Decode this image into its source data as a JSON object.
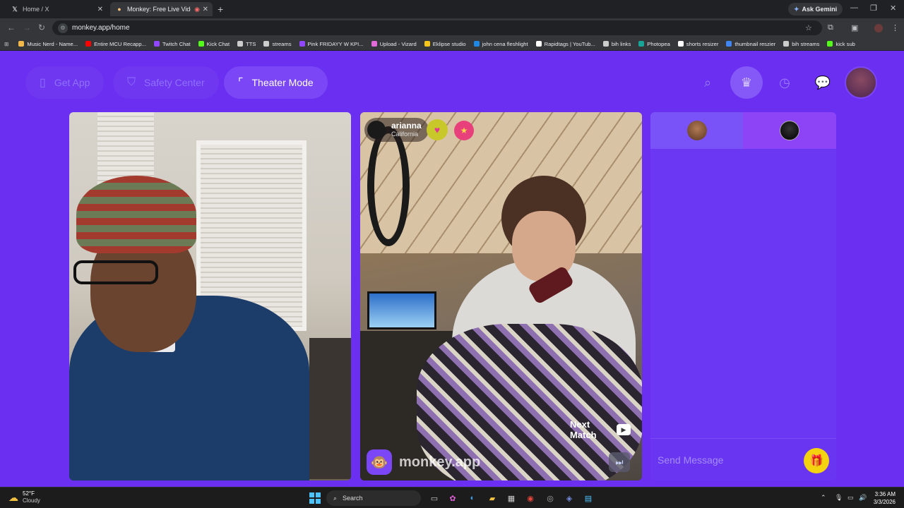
{
  "browser": {
    "tabs": [
      {
        "label": "Home / X",
        "icon": "x-icon"
      },
      {
        "label": "Monkey: Free Live Video Ch",
        "icon": "monkey-icon",
        "active": true
      }
    ],
    "gemini_label": "Ask Gemini",
    "url": "monkey.app/home",
    "bookmarks": [
      {
        "label": "Music Nerd - Name...",
        "color": "#f2b84b"
      },
      {
        "label": "Entire MCU Recapp...",
        "color": "#ff0000"
      },
      {
        "label": "Twitch Chat",
        "color": "#9146ff"
      },
      {
        "label": "Kick Chat",
        "color": "#53fc18"
      },
      {
        "label": "TTS",
        "color": "#cccccc"
      },
      {
        "label": "streams",
        "color": "#cccccc"
      },
      {
        "label": "Pink FRIDAYY W KPI...",
        "color": "#9146ff"
      },
      {
        "label": "Upload - Vizard",
        "color": "#e06bd8"
      },
      {
        "label": "Eklipse studio",
        "color": "#f5c518"
      },
      {
        "label": "john cena fleshlight",
        "color": "#1e88e5"
      },
      {
        "label": "Rapidtags | YouTub...",
        "color": "#ffffff"
      },
      {
        "label": "bih links",
        "color": "#cccccc"
      },
      {
        "label": "Photopea",
        "color": "#18a497"
      },
      {
        "label": "shorts resizer",
        "color": "#ffffff"
      },
      {
        "label": "thumbnail reszier",
        "color": "#4285f4"
      },
      {
        "label": "bih streams",
        "color": "#cccccc"
      },
      {
        "label": "kick sub",
        "color": "#53fc18"
      }
    ]
  },
  "header": {
    "get_app": "Get App",
    "safety_center": "Safety Center",
    "theater_mode": "Theater Mode"
  },
  "peer": {
    "name": "arianna",
    "location": "California"
  },
  "controls": {
    "next_match": "Next Match",
    "watermark": "monkey.app"
  },
  "chat": {
    "placeholder": "Send Message"
  },
  "taskbar": {
    "weather_temp": "52°F",
    "weather_desc": "Cloudy",
    "search_label": "Search",
    "time": "3:36 AM",
    "date": "3/3/2026"
  },
  "colors": {
    "page_bg": "#6a2ff0",
    "accent": "#7a46f6",
    "gift": "#f4d20f"
  }
}
